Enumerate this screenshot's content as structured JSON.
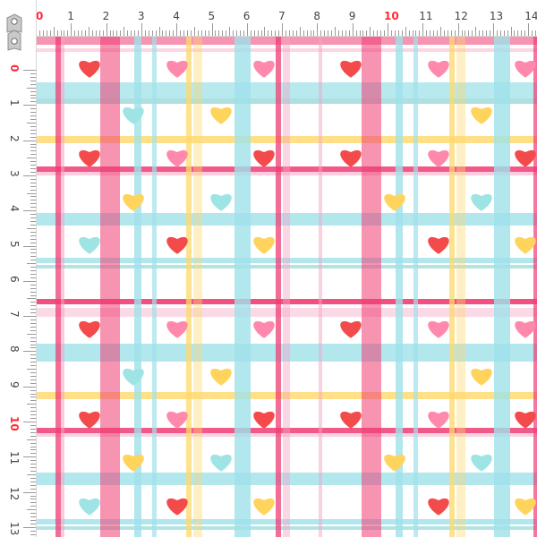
{
  "ruler": {
    "top_labels": [
      "0",
      "1",
      "2",
      "3",
      "4",
      "5",
      "6",
      "7",
      "8",
      "9",
      "10",
      "11",
      "12",
      "13",
      "14"
    ],
    "left_labels": [
      "0",
      "1",
      "2",
      "3",
      "4",
      "5",
      "6",
      "7",
      "8",
      "9",
      "10",
      "11",
      "12",
      "13"
    ],
    "highlight_color": "#ff2a3a"
  },
  "pattern": {
    "colors": {
      "pink": "#f6a3c3",
      "hot_pink": "#ef3d73",
      "aqua": "#9fe1ea",
      "teal": "#6cc7c7",
      "yellow": "#ffd86b",
      "red_heart": "#f34b4b",
      "pink_heart": "#ff89ad",
      "aqua_heart": "#9fe4e4",
      "yellow_heart": "#ffd45d"
    }
  }
}
